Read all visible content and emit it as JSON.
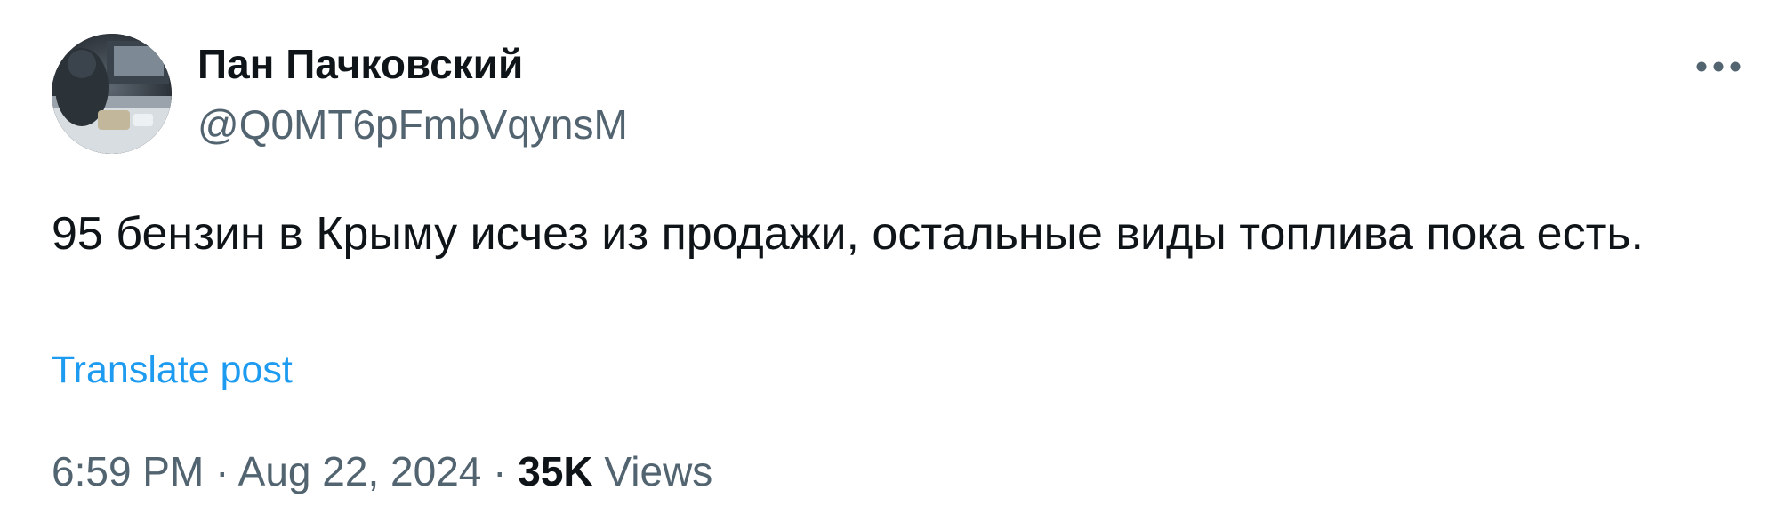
{
  "author": {
    "display_name": "Пан Пачковский",
    "handle": "@Q0MT6pFmbVqynsM",
    "avatar_icon": "user-avatar-photo"
  },
  "more_icon": "ellipsis-icon",
  "post": {
    "text": "95 бензин в Крыму исчез из продажи, остальные виды топлива пока есть.",
    "translate_label": "Translate post"
  },
  "meta": {
    "time": "6:59 PM",
    "separator": "·",
    "date": "Aug 22, 2024",
    "views_count": "35K",
    "views_label": "Views"
  },
  "colors": {
    "text_primary": "#0f1419",
    "text_secondary": "#536471",
    "link": "#1d9bf0"
  }
}
